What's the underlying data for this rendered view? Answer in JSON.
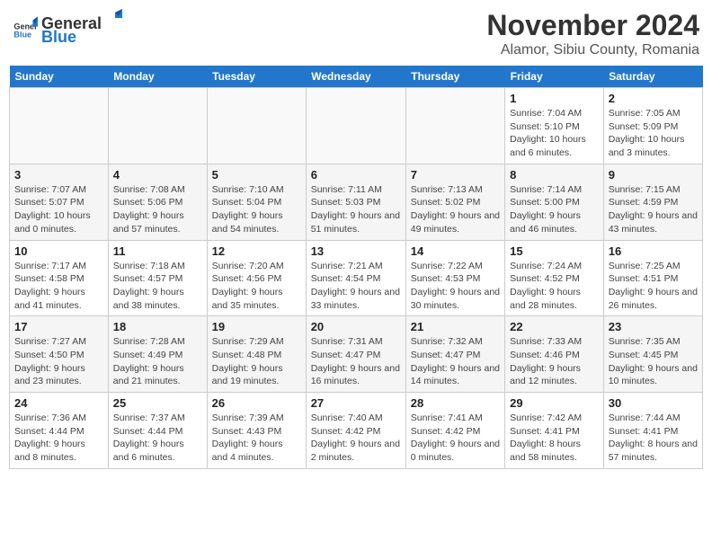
{
  "logo": {
    "general": "General",
    "blue": "Blue"
  },
  "header": {
    "month": "November 2024",
    "location": "Alamor, Sibiu County, Romania"
  },
  "weekdays": [
    "Sunday",
    "Monday",
    "Tuesday",
    "Wednesday",
    "Thursday",
    "Friday",
    "Saturday"
  ],
  "weeks": [
    [
      {
        "day": "",
        "info": ""
      },
      {
        "day": "",
        "info": ""
      },
      {
        "day": "",
        "info": ""
      },
      {
        "day": "",
        "info": ""
      },
      {
        "day": "",
        "info": ""
      },
      {
        "day": "1",
        "info": "Sunrise: 7:04 AM\nSunset: 5:10 PM\nDaylight: 10 hours and 6 minutes."
      },
      {
        "day": "2",
        "info": "Sunrise: 7:05 AM\nSunset: 5:09 PM\nDaylight: 10 hours and 3 minutes."
      }
    ],
    [
      {
        "day": "3",
        "info": "Sunrise: 7:07 AM\nSunset: 5:07 PM\nDaylight: 10 hours and 0 minutes."
      },
      {
        "day": "4",
        "info": "Sunrise: 7:08 AM\nSunset: 5:06 PM\nDaylight: 9 hours and 57 minutes."
      },
      {
        "day": "5",
        "info": "Sunrise: 7:10 AM\nSunset: 5:04 PM\nDaylight: 9 hours and 54 minutes."
      },
      {
        "day": "6",
        "info": "Sunrise: 7:11 AM\nSunset: 5:03 PM\nDaylight: 9 hours and 51 minutes."
      },
      {
        "day": "7",
        "info": "Sunrise: 7:13 AM\nSunset: 5:02 PM\nDaylight: 9 hours and 49 minutes."
      },
      {
        "day": "8",
        "info": "Sunrise: 7:14 AM\nSunset: 5:00 PM\nDaylight: 9 hours and 46 minutes."
      },
      {
        "day": "9",
        "info": "Sunrise: 7:15 AM\nSunset: 4:59 PM\nDaylight: 9 hours and 43 minutes."
      }
    ],
    [
      {
        "day": "10",
        "info": "Sunrise: 7:17 AM\nSunset: 4:58 PM\nDaylight: 9 hours and 41 minutes."
      },
      {
        "day": "11",
        "info": "Sunrise: 7:18 AM\nSunset: 4:57 PM\nDaylight: 9 hours and 38 minutes."
      },
      {
        "day": "12",
        "info": "Sunrise: 7:20 AM\nSunset: 4:56 PM\nDaylight: 9 hours and 35 minutes."
      },
      {
        "day": "13",
        "info": "Sunrise: 7:21 AM\nSunset: 4:54 PM\nDaylight: 9 hours and 33 minutes."
      },
      {
        "day": "14",
        "info": "Sunrise: 7:22 AM\nSunset: 4:53 PM\nDaylight: 9 hours and 30 minutes."
      },
      {
        "day": "15",
        "info": "Sunrise: 7:24 AM\nSunset: 4:52 PM\nDaylight: 9 hours and 28 minutes."
      },
      {
        "day": "16",
        "info": "Sunrise: 7:25 AM\nSunset: 4:51 PM\nDaylight: 9 hours and 26 minutes."
      }
    ],
    [
      {
        "day": "17",
        "info": "Sunrise: 7:27 AM\nSunset: 4:50 PM\nDaylight: 9 hours and 23 minutes."
      },
      {
        "day": "18",
        "info": "Sunrise: 7:28 AM\nSunset: 4:49 PM\nDaylight: 9 hours and 21 minutes."
      },
      {
        "day": "19",
        "info": "Sunrise: 7:29 AM\nSunset: 4:48 PM\nDaylight: 9 hours and 19 minutes."
      },
      {
        "day": "20",
        "info": "Sunrise: 7:31 AM\nSunset: 4:47 PM\nDaylight: 9 hours and 16 minutes."
      },
      {
        "day": "21",
        "info": "Sunrise: 7:32 AM\nSunset: 4:47 PM\nDaylight: 9 hours and 14 minutes."
      },
      {
        "day": "22",
        "info": "Sunrise: 7:33 AM\nSunset: 4:46 PM\nDaylight: 9 hours and 12 minutes."
      },
      {
        "day": "23",
        "info": "Sunrise: 7:35 AM\nSunset: 4:45 PM\nDaylight: 9 hours and 10 minutes."
      }
    ],
    [
      {
        "day": "24",
        "info": "Sunrise: 7:36 AM\nSunset: 4:44 PM\nDaylight: 9 hours and 8 minutes."
      },
      {
        "day": "25",
        "info": "Sunrise: 7:37 AM\nSunset: 4:44 PM\nDaylight: 9 hours and 6 minutes."
      },
      {
        "day": "26",
        "info": "Sunrise: 7:39 AM\nSunset: 4:43 PM\nDaylight: 9 hours and 4 minutes."
      },
      {
        "day": "27",
        "info": "Sunrise: 7:40 AM\nSunset: 4:42 PM\nDaylight: 9 hours and 2 minutes."
      },
      {
        "day": "28",
        "info": "Sunrise: 7:41 AM\nSunset: 4:42 PM\nDaylight: 9 hours and 0 minutes."
      },
      {
        "day": "29",
        "info": "Sunrise: 7:42 AM\nSunset: 4:41 PM\nDaylight: 8 hours and 58 minutes."
      },
      {
        "day": "30",
        "info": "Sunrise: 7:44 AM\nSunset: 4:41 PM\nDaylight: 8 hours and 57 minutes."
      }
    ]
  ]
}
